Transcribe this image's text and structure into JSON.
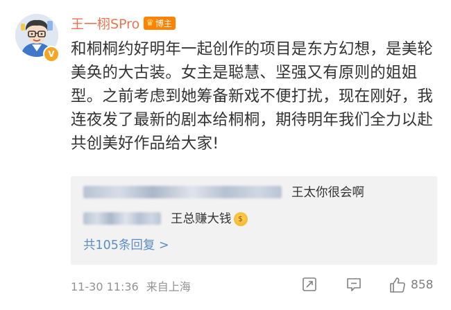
{
  "author": {
    "name": "王一栩SPro",
    "badge": "博主",
    "avatar_icon": "cartoon-avatar-icon",
    "verified_mark": "V"
  },
  "post": {
    "text": "和桐桐约好明年一起创作的项目是东方幻想，是美轮美奂的大古装。女主是聪慧、坚强又有原则的姐姐型。之前考虑到她筹备新戏不便打扰，现在刚好，我连夜发了最新的剧本给桐桐，期待明年我们全力以赴共创美好作品给大家!"
  },
  "replies": {
    "items": [
      {
        "text": "王太你很会啊"
      },
      {
        "text": "王总赚大钱",
        "emoji": "money-eyes-emoji"
      }
    ],
    "more_label": "共105条回复 >"
  },
  "footer": {
    "timestamp": "11-30 11:36",
    "source": "来自上海",
    "like_count": "858"
  },
  "colors": {
    "username": "#eb7350",
    "link": "#5b8ec4",
    "meta": "#939393",
    "badge": "#ff8200",
    "reply_bg": "#f2f2f2"
  }
}
